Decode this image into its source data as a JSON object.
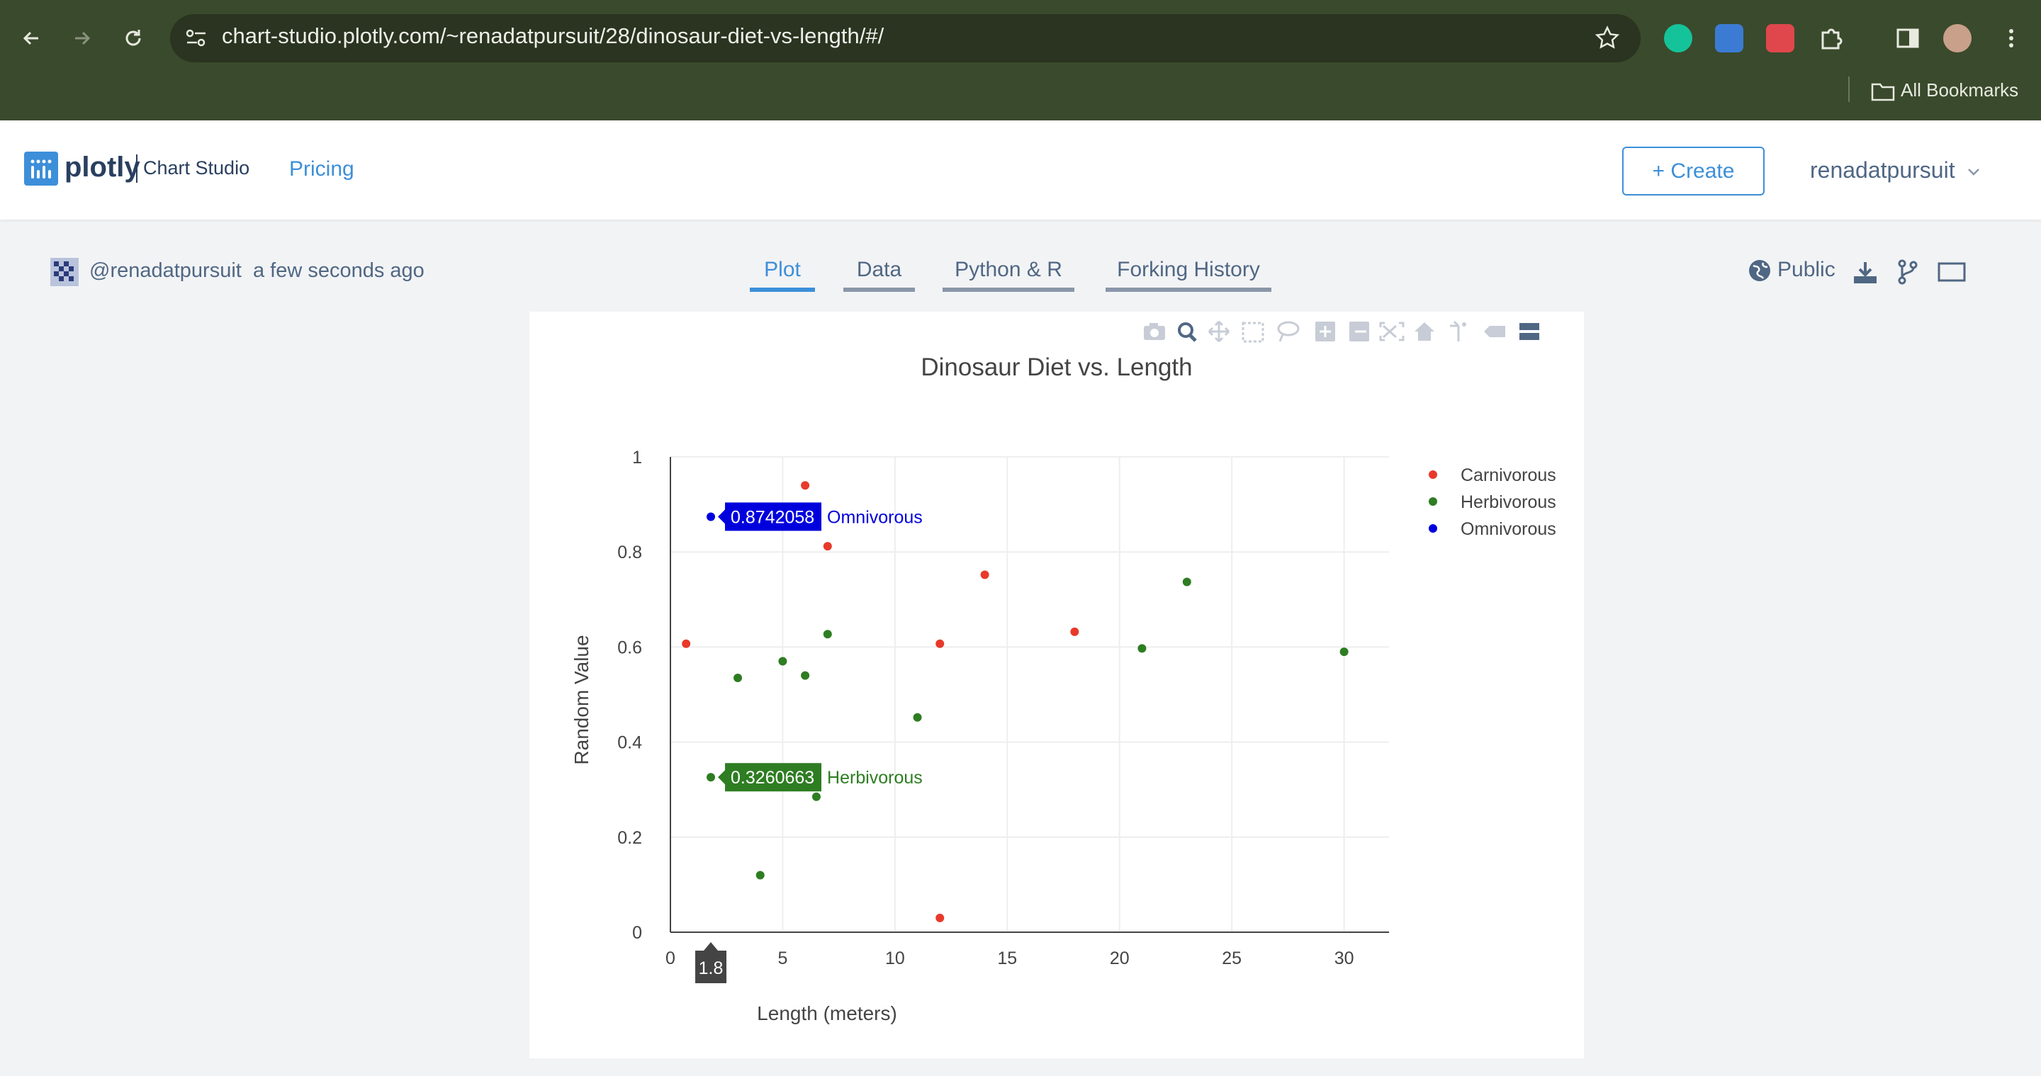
{
  "browser": {
    "url": "chart-studio.plotly.com/~renadatpursuit/28/dinosaur-diet-vs-length/#/",
    "bookmarks_label": "All Bookmarks",
    "icons": [
      "back-arrow-icon",
      "forward-arrow-icon",
      "reload-icon",
      "site-settings-icon",
      "bookmark-star-icon",
      "grammarly-icon",
      "extension-icon",
      "extension-icon",
      "puzzle-icon",
      "sidepanel-icon",
      "profile-avatar-icon",
      "more-vertical-icon",
      "folder-icon"
    ]
  },
  "header": {
    "logo_word": "plotly",
    "logo_sub": "Chart Studio",
    "pricing": "Pricing",
    "create": "+ Create",
    "user": "renadatpursuit",
    "brand_color": "#3d8fd9"
  },
  "meta": {
    "author": "@renadatpursuit",
    "timestamp": "a few seconds ago",
    "visibility": "Public"
  },
  "tabs": [
    {
      "label": "Plot",
      "active": true
    },
    {
      "label": "Data",
      "active": false
    },
    {
      "label": "Python & R",
      "active": false
    },
    {
      "label": "Forking History",
      "active": false
    }
  ],
  "modebar_icons": [
    "camera-icon",
    "zoom-icon",
    "pan-icon",
    "box-select-icon",
    "lasso-icon",
    "zoom-in-icon",
    "zoom-out-icon",
    "autoscale-icon",
    "reset-axes-icon",
    "spike-lines-icon",
    "hover-closest-icon",
    "hover-compare-icon"
  ],
  "chart_data": {
    "type": "scatter",
    "title": "Dinosaur Diet vs. Length",
    "xlabel": "Length (meters)",
    "ylabel": "Random Value",
    "xlim": [
      0,
      32
    ],
    "ylim": [
      0,
      1
    ],
    "xticks": [
      "0",
      "5",
      "10",
      "15",
      "20",
      "25",
      "30"
    ],
    "xtick_values": [
      0,
      5,
      10,
      15,
      20,
      25,
      30
    ],
    "yticks": [
      "0",
      "0.2",
      "0.4",
      "0.6",
      "0.8",
      "1"
    ],
    "ytick_values": [
      0,
      0.2,
      0.4,
      0.6,
      0.8,
      1
    ],
    "grid": true,
    "legend_position": "top-right",
    "series": [
      {
        "name": "Carnivorous",
        "color": "#e8392a",
        "x": [
          0.7,
          6,
          7,
          12,
          14,
          18,
          12
        ],
        "y": [
          0.607,
          0.94,
          0.812,
          0.607,
          0.752,
          0.632,
          0.03
        ]
      },
      {
        "name": "Herbivorous",
        "color": "#2e7d22",
        "x": [
          1.8,
          3,
          4,
          5,
          6,
          6.5,
          7,
          11,
          21,
          23,
          30
        ],
        "y": [
          0.326,
          0.535,
          0.12,
          0.57,
          0.54,
          0.285,
          0.627,
          0.452,
          0.597,
          0.737,
          0.59
        ]
      },
      {
        "name": "Omnivorous",
        "color": "#0000dd",
        "x": [
          1.8
        ],
        "y": [
          0.874
        ]
      }
    ],
    "hover": {
      "x_label": "1.8",
      "labels": [
        {
          "value": "0.8742058",
          "series": "Omnivorous",
          "x": 1.8,
          "y": 0.8742058,
          "color": "#0000dd"
        },
        {
          "value": "0.3260663",
          "series": "Herbivorous",
          "x": 1.8,
          "y": 0.3260663,
          "color": "#2e7d22"
        }
      ]
    }
  }
}
